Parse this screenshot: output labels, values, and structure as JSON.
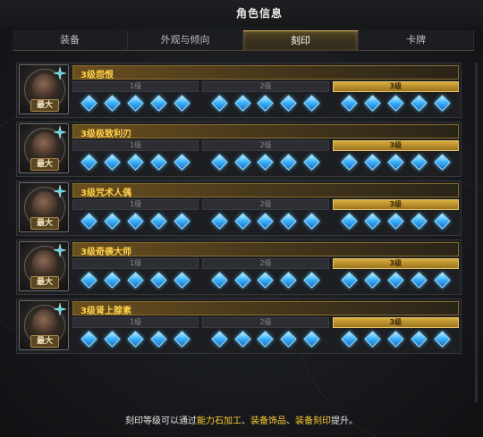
{
  "window": {
    "title": "角色信息"
  },
  "tabs": [
    {
      "label": "装备",
      "active": false
    },
    {
      "label": "外观与倾向",
      "active": false
    },
    {
      "label": "刻印",
      "active": true
    },
    {
      "label": "卡牌",
      "active": false
    }
  ],
  "engravings": [
    {
      "name": "3级怨恨",
      "portrait_icon": "grudge-portrait-icon",
      "max_label": "最大",
      "levels": [
        {
          "label": "1级",
          "gems": 5
        },
        {
          "label": "2级",
          "gems": 5
        },
        {
          "label": "3级",
          "gems": 5
        }
      ],
      "active_level_index": 2
    },
    {
      "name": "3级极致利刃",
      "portrait_icon": "keen-blunt-weapon-portrait-icon",
      "max_label": "最大",
      "levels": [
        {
          "label": "1级",
          "gems": 5
        },
        {
          "label": "2级",
          "gems": 5
        },
        {
          "label": "3级",
          "gems": 5
        }
      ],
      "active_level_index": 2
    },
    {
      "name": "3级咒术人偶",
      "portrait_icon": "cursed-doll-portrait-icon",
      "max_label": "最大",
      "levels": [
        {
          "label": "1级",
          "gems": 5
        },
        {
          "label": "2级",
          "gems": 5
        },
        {
          "label": "3级",
          "gems": 5
        }
      ],
      "active_level_index": 2
    },
    {
      "name": "3级奇袭大师",
      "portrait_icon": "master-of-ambush-portrait-icon",
      "max_label": "最大",
      "levels": [
        {
          "label": "1级",
          "gems": 5
        },
        {
          "label": "2级",
          "gems": 5
        },
        {
          "label": "3级",
          "gems": 5
        }
      ],
      "active_level_index": 2
    },
    {
      "name": "3级肾上腺素",
      "portrait_icon": "adrenaline-portrait-icon",
      "max_label": "最大",
      "levels": [
        {
          "label": "1级",
          "gems": 5
        },
        {
          "label": "2级",
          "gems": 5
        },
        {
          "label": "3级",
          "gems": 5
        }
      ],
      "active_level_index": 2
    }
  ],
  "footer": {
    "prefix": "刻印等级可以通过",
    "highlight1": "能力石加工",
    "sep1": "、",
    "highlight2": "装备饰品",
    "sep2": "、",
    "highlight3": "装备刻印",
    "suffix": "提升。"
  },
  "colors": {
    "accent_gold": "#ffd24a",
    "active_level": "#d8ac3c",
    "gem_blue": "#3fb5ff",
    "footer_highlight": "#ffcc33"
  }
}
